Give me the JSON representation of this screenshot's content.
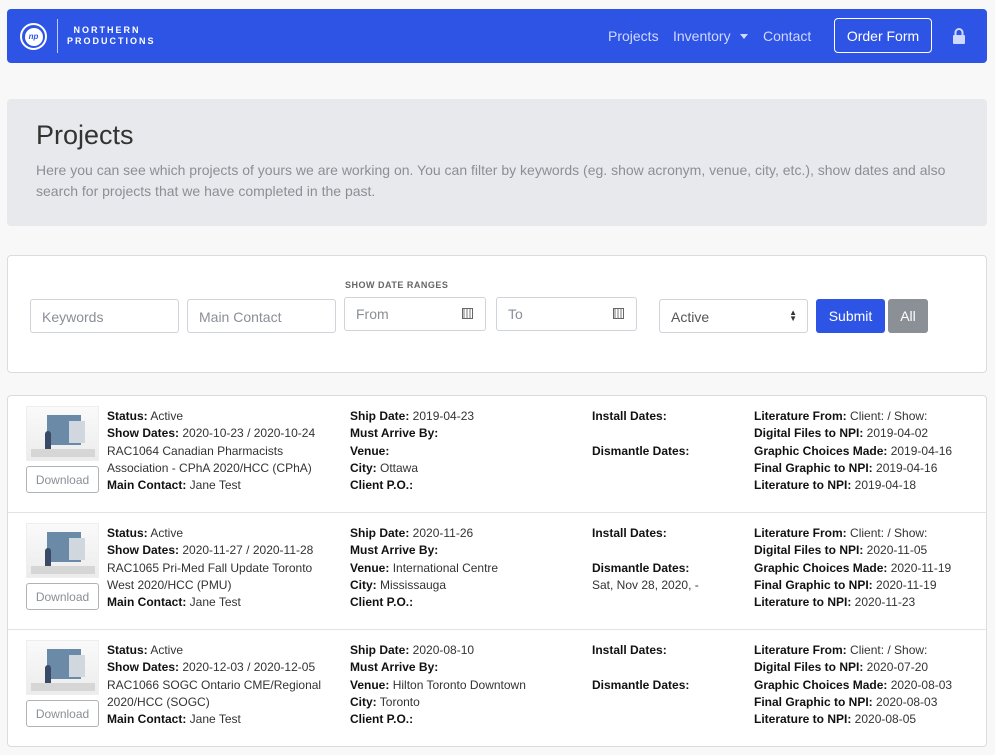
{
  "nav": {
    "brand": "NORTHERN PRODUCTIONS",
    "brand_line1": "NORTHERN",
    "brand_line2": "PRODUCTIONS",
    "logo_initials": "np",
    "projects": "Projects",
    "inventory": "Inventory",
    "contact": "Contact",
    "order_form": "Order Form",
    "bg_color": "#2e54e6"
  },
  "jumbotron": {
    "title": "Projects",
    "description": "Here you can see which projects of yours we are working on. You can filter by keywords (eg. show acronym, venue, city, etc.), show dates and also search for projects that we have completed in the past."
  },
  "filters": {
    "keywords_placeholder": "Keywords",
    "contact_placeholder": "Main Contact",
    "range_label": "SHOW DATE RANGES",
    "from_placeholder": "From",
    "to_placeholder": "To",
    "status_value": "Active",
    "submit": "Submit",
    "all": "All"
  },
  "labels": {
    "status": "Status:",
    "show_dates": "Show Dates:",
    "main_contact": "Main Contact:",
    "ship_date": "Ship Date:",
    "must_arrive": "Must Arrive By:",
    "venue": "Venue:",
    "city": "City:",
    "client_po": "Client P.O.:",
    "install_dates": "Install Dates:",
    "dismantle_dates": "Dismantle Dates:",
    "literature_from": "Literature From:",
    "digital_files": "Digital Files to NPI:",
    "graphic_choices": "Graphic Choices Made:",
    "final_graphic": "Final Graphic to NPI:",
    "literature_to": "Literature to NPI:",
    "download": "Download"
  },
  "projects": [
    {
      "status": " Active",
      "show_dates": " 2020-10-23 / 2020-10-24",
      "name": "RAC1064 Canadian Pharmacists Association - CPhA 2020/HCC (CPhA)",
      "main_contact": " Jane Test",
      "ship_date": " 2019-04-23",
      "must_arrive": "",
      "venue": "",
      "city": " Ottawa",
      "client_po": "",
      "install_dates": "",
      "dismantle_dates": "",
      "literature_from": " Client: / Show:",
      "digital_files": " 2019-04-02",
      "graphic_choices": " 2019-04-16",
      "final_graphic": " 2019-04-16",
      "literature_to": " 2019-04-18"
    },
    {
      "status": " Active",
      "show_dates": " 2020-11-27 / 2020-11-28",
      "name": "RAC1065 Pri-Med Fall Update Toronto West 2020/HCC (PMU)",
      "main_contact": " Jane Test",
      "ship_date": " 2020-11-26",
      "must_arrive": "",
      "venue": " International Centre",
      "city": " Mississauga",
      "client_po": "",
      "install_dates": "",
      "dismantle_dates": "Sat, Nov 28, 2020, -",
      "literature_from": " Client: / Show:",
      "digital_files": " 2020-11-05",
      "graphic_choices": " 2020-11-19",
      "final_graphic": " 2020-11-19",
      "literature_to": " 2020-11-23"
    },
    {
      "status": " Active",
      "show_dates": " 2020-12-03 / 2020-12-05",
      "name": "RAC1066 SOGC Ontario CME/Regional 2020/HCC (SOGC)",
      "main_contact": " Jane Test",
      "ship_date": " 2020-08-10",
      "must_arrive": "",
      "venue": " Hilton Toronto Downtown",
      "city": " Toronto",
      "client_po": "",
      "install_dates": "",
      "dismantle_dates": "",
      "literature_from": " Client: / Show:",
      "digital_files": " 2020-07-20",
      "graphic_choices": " 2020-08-03",
      "final_graphic": " 2020-08-03",
      "literature_to": " 2020-08-05"
    }
  ]
}
